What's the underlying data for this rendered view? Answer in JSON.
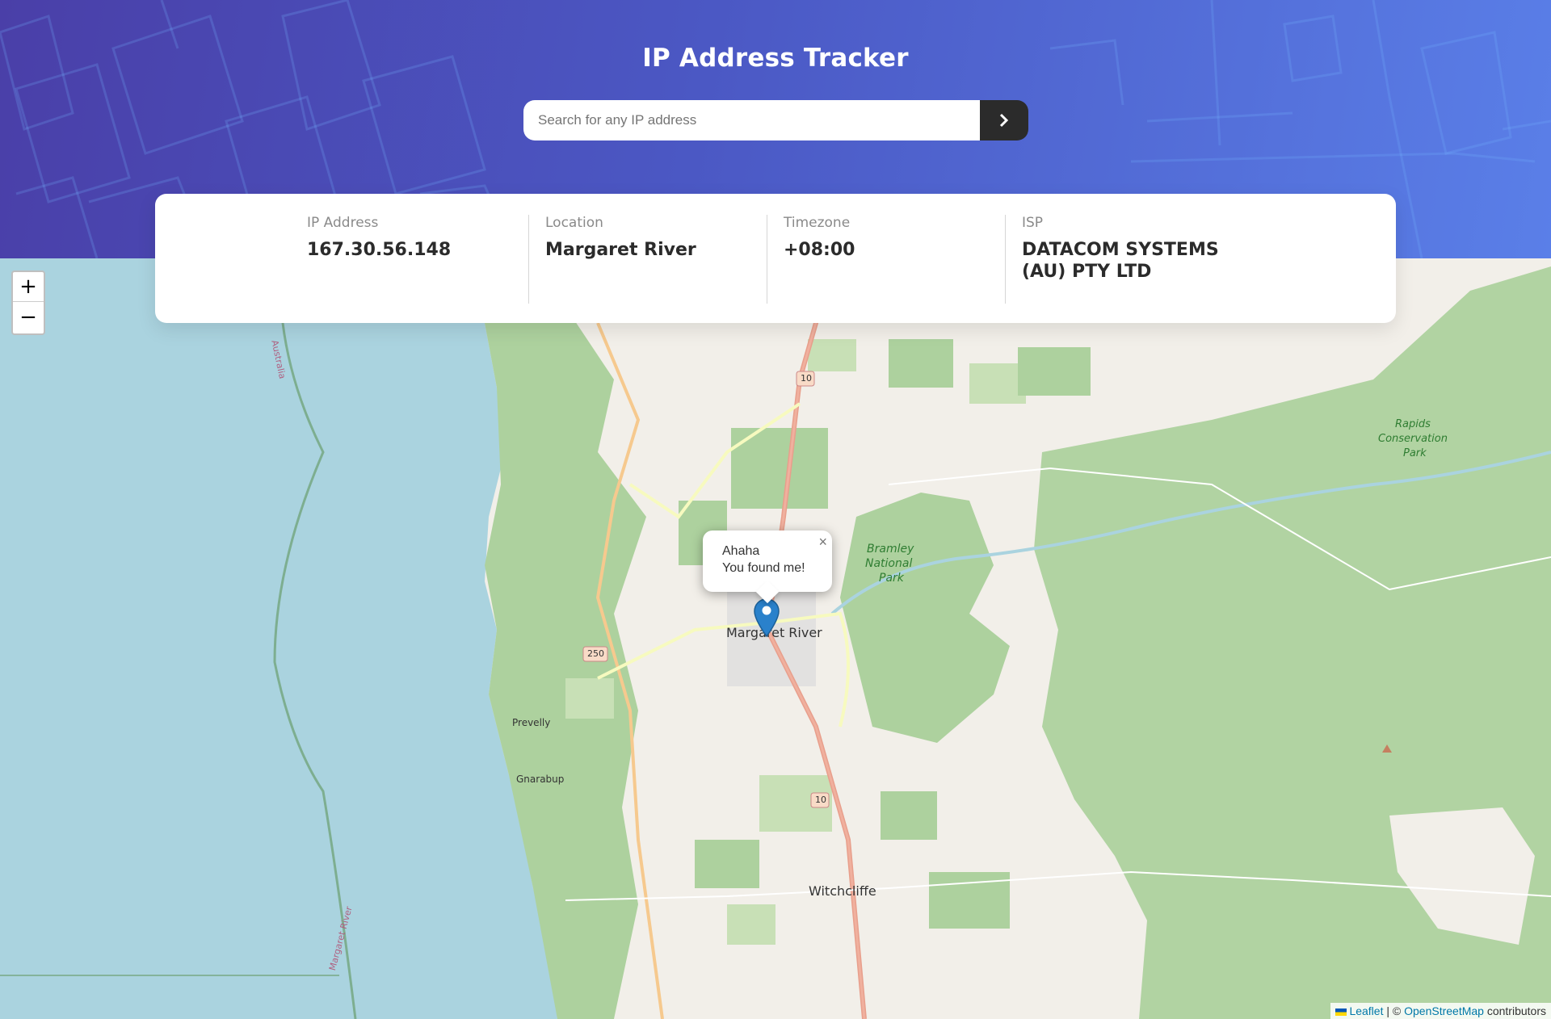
{
  "header": {
    "title": "IP Address Tracker",
    "search_placeholder": "Search for any IP address"
  },
  "info": {
    "ip_label": "IP Address",
    "ip_value": "167.30.56.148",
    "location_label": "Location",
    "location_value": "Margaret River",
    "timezone_label": "Timezone",
    "timezone_value": "+08:00",
    "isp_label": "ISP",
    "isp_value": "DATACOM SYSTEMS (AU) PTY LTD"
  },
  "map": {
    "zoom_in": "+",
    "zoom_out": "−",
    "popup_line1": "Ahaha",
    "popup_line2": "You found me!",
    "popup_close": "×",
    "labels": {
      "margaret_river": "Margaret River",
      "witchcliffe": "Witchcliffe",
      "prevelly": "Prevelly",
      "gnarabup": "Gnarabup",
      "bramley_1": "Bramley",
      "bramley_2": "National",
      "bramley_3": "Park",
      "rapids_1": "Rapids",
      "rapids_2": "Conservation",
      "rapids_3": "Park",
      "road_10_a": "10",
      "road_10_b": "10",
      "road_250": "250",
      "coast_label": "Australia",
      "river_label": "Margaret River"
    },
    "attribution": {
      "leaflet": "Leaflet",
      "separator": " | © ",
      "osm": "OpenStreetMap",
      "suffix": " contributors"
    }
  },
  "colors": {
    "accent_dark": "#2b2b2b",
    "ocean": "#aad3df",
    "forest": "#add19e",
    "land": "#f2efe9",
    "marker": "#2a81cb"
  },
  "icons": {
    "search_button": "chevron-right-icon",
    "marker": "map-pin-icon"
  }
}
